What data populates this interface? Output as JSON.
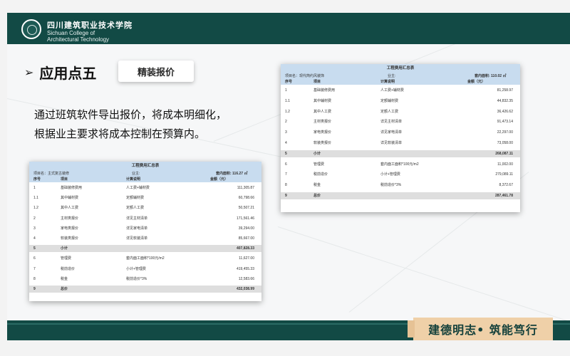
{
  "header": {
    "logo_cn": "四川建筑职业技术学院",
    "logo_en_line1": "Sichuan College of",
    "logo_en_line2": "Architectural Technology"
  },
  "section": {
    "bullet": "➢",
    "title": "应用点五",
    "tag": "精装报价"
  },
  "description": {
    "line1": "通过班筑软件导出报价，将成本明细化，",
    "line2": "根据业主要求将成本控制在预算内。"
  },
  "sheet_left": {
    "title": "工程费用汇总表",
    "project_label": "项目名：主式复古装修",
    "owner_label": "业主:",
    "area_label": "套内面积: 116.27 ㎡",
    "headers": {
      "seq": "序号",
      "item": "项目",
      "calc": "计算说明",
      "amount": "金额（元）"
    },
    "rows": [
      {
        "seq": "1",
        "item": "基础装修费用",
        "calc": "人工费+辅材费",
        "amount": "111,305.87",
        "kind": "normal"
      },
      {
        "seq": "1.1",
        "item": "其中辅材费",
        "calc": "定额辅材费",
        "amount": "60,798.66",
        "kind": "normal"
      },
      {
        "seq": "1.2",
        "item": "其中人工费",
        "calc": "定额人工费",
        "amount": "50,507.21",
        "kind": "normal"
      },
      {
        "seq": "2",
        "item": "主材类报价",
        "calc": "详见主材清单",
        "amount": "171,561.46",
        "kind": "normal"
      },
      {
        "seq": "3",
        "item": "家电类报价",
        "calc": "详见家电清单",
        "amount": "39,294.00",
        "kind": "normal"
      },
      {
        "seq": "4",
        "item": "软装类报价",
        "calc": "详见软装清单",
        "amount": "85,667.00",
        "kind": "normal"
      },
      {
        "seq": "5",
        "item": "小计",
        "calc": "",
        "amount": "407,828.33",
        "kind": "sub"
      },
      {
        "seq": "6",
        "item": "管理费",
        "calc": "套内面工面积*100元/m2",
        "amount": "11,627.00",
        "kind": "normal"
      },
      {
        "seq": "7",
        "item": "税前造价",
        "calc": "小计+管理费",
        "amount": "419,455.33",
        "kind": "normal"
      },
      {
        "seq": "8",
        "item": "税金",
        "calc": "税前造价*3%",
        "amount": "12,583.66",
        "kind": "normal"
      },
      {
        "seq": "9",
        "item": "总价",
        "calc": "",
        "amount": "432,038.99",
        "kind": "total"
      }
    ]
  },
  "sheet_right": {
    "title": "工程费用汇总表",
    "project_label": "项目名：现代简约风装饰",
    "owner_label": "业主:",
    "area_label": "套内面积: 110.02 ㎡",
    "headers": {
      "seq": "序号",
      "item": "项目",
      "calc": "计算说明",
      "amount": "金额（元）"
    },
    "rows": [
      {
        "seq": "1",
        "item": "基础装修费用",
        "calc": "人工费+辅材费",
        "amount": "81,258.97",
        "kind": "normal"
      },
      {
        "seq": "1.1",
        "item": "其中辅材费",
        "calc": "定额辅材费",
        "amount": "44,832.35",
        "kind": "normal"
      },
      {
        "seq": "1.2",
        "item": "其中人工费",
        "calc": "定额人工费",
        "amount": "36,426.62",
        "kind": "normal"
      },
      {
        "seq": "2",
        "item": "主材类报价",
        "calc": "详见主材清单",
        "amount": "91,473.14",
        "kind": "normal"
      },
      {
        "seq": "3",
        "item": "家电类报价",
        "calc": "详见家电清单",
        "amount": "22,297.00",
        "kind": "normal"
      },
      {
        "seq": "4",
        "item": "软装类报价",
        "calc": "详见软装清单",
        "amount": "73,058.00",
        "kind": "normal"
      },
      {
        "seq": "5",
        "item": "小计",
        "calc": "",
        "amount": "268,087.11",
        "kind": "sub"
      },
      {
        "seq": "6",
        "item": "管理费",
        "calc": "套内面工面积*100元/m2",
        "amount": "11,002.00",
        "kind": "normal"
      },
      {
        "seq": "7",
        "item": "税前造价",
        "calc": "小计+管理费",
        "amount": "279,089.11",
        "kind": "normal"
      },
      {
        "seq": "8",
        "item": "税金",
        "calc": "税前造价*3%",
        "amount": "8,372.67",
        "kind": "normal"
      },
      {
        "seq": "9",
        "item": "总价",
        "calc": "",
        "amount": "287,461.78",
        "kind": "total"
      }
    ]
  },
  "footer": {
    "motto": "建德明志• 筑能笃行"
  }
}
